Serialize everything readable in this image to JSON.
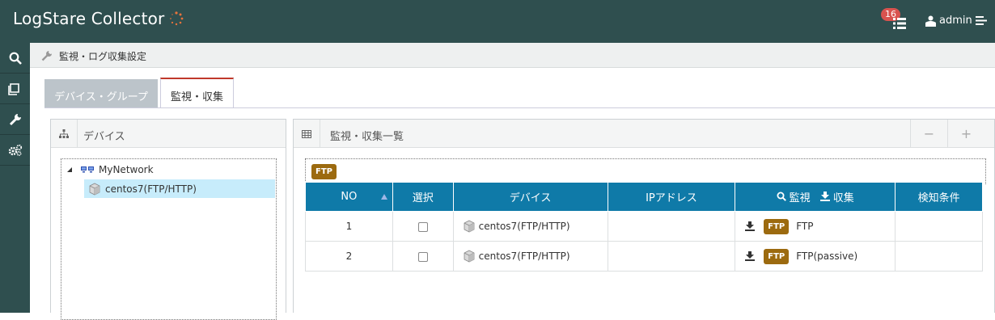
{
  "header": {
    "app_title": "LogStare Collector",
    "notification_count": "16",
    "user_name": "admin"
  },
  "sidebar": {
    "items": [
      {
        "name": "search"
      },
      {
        "name": "book"
      },
      {
        "name": "wrench"
      },
      {
        "name": "cogs"
      }
    ]
  },
  "breadcrumb": {
    "text": "監視・ログ収集設定"
  },
  "tabs": [
    {
      "label": "デバイス・グループ",
      "active": false
    },
    {
      "label": "監視・収集",
      "active": true
    }
  ],
  "device_panel": {
    "title": "デバイス",
    "tree": {
      "root": "MyNetwork",
      "children": [
        "centos7(FTP/HTTP)"
      ]
    }
  },
  "list_panel": {
    "title": "監視・収集一覧",
    "minus_label": "−",
    "plus_label": "+",
    "filter_badge": "FTP",
    "columns": {
      "no": "NO",
      "select": "選択",
      "device": "デバイス",
      "ip": "IPアドレス",
      "monitor": "監視",
      "collect": "収集",
      "condition": "検知条件"
    },
    "rows": [
      {
        "no": "1",
        "device": "centos7(FTP/HTTP)",
        "ip": "",
        "badge": "FTP",
        "service": "FTP",
        "condition": ""
      },
      {
        "no": "2",
        "device": "centos7(FTP/HTTP)",
        "ip": "",
        "badge": "FTP",
        "service": "FTP(passive)",
        "condition": ""
      }
    ]
  },
  "colors": {
    "header_bg": "#2f4f4f",
    "table_header_bg": "#0f7aa8",
    "ftp_badge": "#9c6a0f",
    "selected_row": "#c7ecfb",
    "active_tab_accent": "#c0392b",
    "notification_badge": "#d9534f"
  }
}
